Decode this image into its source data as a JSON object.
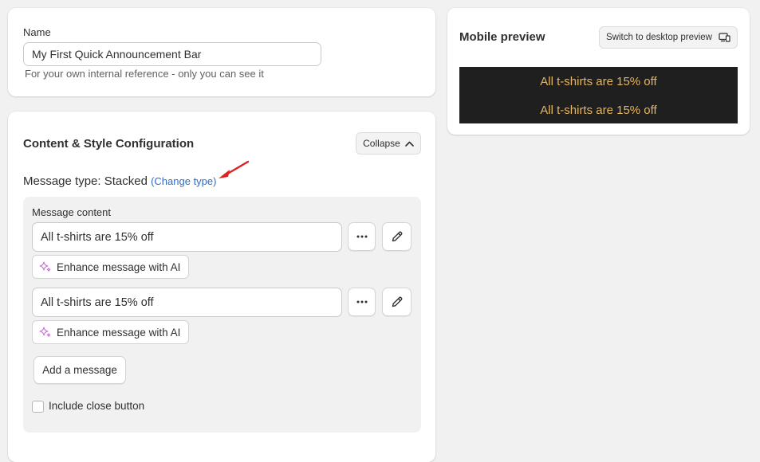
{
  "name_section": {
    "label": "Name",
    "value": "My First Quick Announcement Bar",
    "help_text": "For your own internal reference - only you can see it"
  },
  "content_section": {
    "title": "Content & Style Configuration",
    "collapse_label": "Collapse",
    "message_type_prefix": "Message type: ",
    "message_type_value": "Stacked",
    "change_type_label": "(Change type)",
    "message_content_label": "Message content",
    "messages": [
      {
        "text": "All t-shirts are 15% off",
        "enhance_label": "Enhance message with AI"
      },
      {
        "text": "All t-shirts are 15% off",
        "enhance_label": "Enhance message with AI"
      }
    ],
    "add_message_label": "Add a message",
    "include_close_label": "Include close button",
    "include_close_checked": false
  },
  "preview": {
    "title": "Mobile preview",
    "switch_label": "Switch to desktop preview",
    "banner_lines": [
      "All t-shirts are 15% off",
      "All t-shirts are 15% off"
    ],
    "banner_bg": "#1f1f1f",
    "banner_text_color": "#e8b45c"
  },
  "colors": {
    "link": "#2c6ecb",
    "annotation_arrow": "#e02020",
    "ai_sparkle": "#c96fd8"
  }
}
